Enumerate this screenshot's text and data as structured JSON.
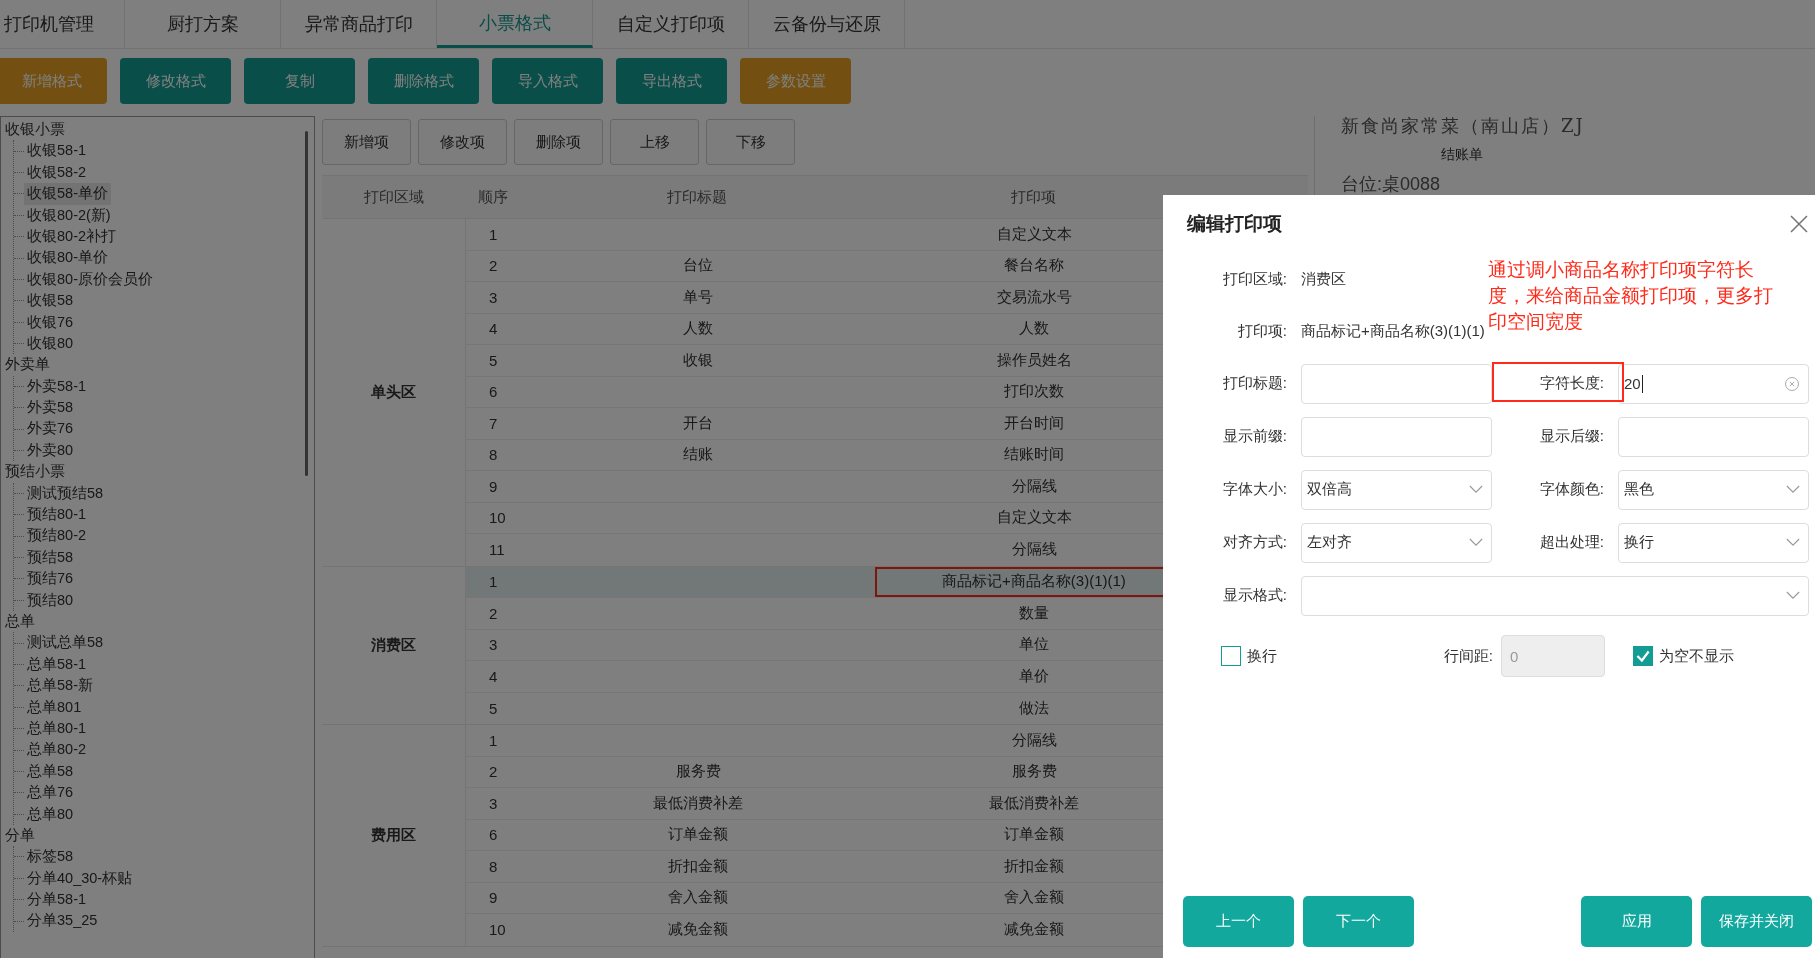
{
  "tabs": [
    {
      "label": "打印机管理",
      "selected": false
    },
    {
      "label": "厨打方案",
      "selected": false
    },
    {
      "label": "异常商品打印",
      "selected": false
    },
    {
      "label": "小票格式",
      "selected": true
    },
    {
      "label": "自定义打印项",
      "selected": false
    },
    {
      "label": "云备份与还原",
      "selected": false
    }
  ],
  "toolbar": [
    {
      "label": "新增格式",
      "kind": "warning"
    },
    {
      "label": "修改格式",
      "kind": "primary"
    },
    {
      "label": "复制",
      "kind": "primary"
    },
    {
      "label": "删除格式",
      "kind": "primary"
    },
    {
      "label": "导入格式",
      "kind": "primary"
    },
    {
      "label": "导出格式",
      "kind": "primary"
    },
    {
      "label": "参数设置",
      "kind": "warning"
    }
  ],
  "tree": [
    {
      "label": "收银小票",
      "children": [
        {
          "label": "收银58-1",
          "selected": false
        },
        {
          "label": "收银58-2",
          "selected": false
        },
        {
          "label": "收银58-单价",
          "selected": true
        },
        {
          "label": "收银80-2(新)",
          "selected": false
        },
        {
          "label": "收银80-2补打",
          "selected": false
        },
        {
          "label": "收银80-单价",
          "selected": false
        },
        {
          "label": "收银80-原价会员价",
          "selected": false
        },
        {
          "label": "收银58",
          "selected": false
        },
        {
          "label": "收银76",
          "selected": false
        },
        {
          "label": "收银80",
          "selected": false
        }
      ]
    },
    {
      "label": "外卖单",
      "children": [
        {
          "label": "外卖58-1",
          "selected": false
        },
        {
          "label": "外卖58",
          "selected": false
        },
        {
          "label": "外卖76",
          "selected": false
        },
        {
          "label": "外卖80",
          "selected": false
        }
      ]
    },
    {
      "label": "预结小票",
      "children": [
        {
          "label": "测试预结58",
          "selected": false
        },
        {
          "label": "预结80-1",
          "selected": false
        },
        {
          "label": "预结80-2",
          "selected": false
        },
        {
          "label": "预结58",
          "selected": false
        },
        {
          "label": "预结76",
          "selected": false
        },
        {
          "label": "预结80",
          "selected": false
        }
      ]
    },
    {
      "label": "总单",
      "children": [
        {
          "label": "测试总单58",
          "selected": false
        },
        {
          "label": "总单58-1",
          "selected": false
        },
        {
          "label": "总单58-新",
          "selected": false
        },
        {
          "label": "总单801",
          "selected": false
        },
        {
          "label": "总单80-1",
          "selected": false
        },
        {
          "label": "总单80-2",
          "selected": false
        },
        {
          "label": "总单58",
          "selected": false
        },
        {
          "label": "总单76",
          "selected": false
        },
        {
          "label": "总单80",
          "selected": false
        }
      ]
    },
    {
      "label": "分单",
      "children": [
        {
          "label": "标签58",
          "selected": false
        },
        {
          "label": "分单40_30-杯贴",
          "selected": false
        },
        {
          "label": "分单58-1",
          "selected": false
        },
        {
          "label": "分单35_25",
          "selected": false
        }
      ]
    }
  ],
  "item_toolbar": [
    "新增项",
    "修改项",
    "删除项",
    "上移",
    "下移"
  ],
  "table": {
    "columns": [
      "打印区域",
      "顺序",
      "打印标题",
      "打印项"
    ],
    "groups": [
      {
        "area": "单头区",
        "rows": [
          {
            "order": "1",
            "item": "自定义文本",
            "selected": false,
            "marked": false
          },
          {
            "order": "2",
            "title": "台位",
            "item": "餐台名称",
            "selected": false,
            "marked": false
          },
          {
            "order": "3",
            "title": "单号",
            "item": "交易流水号",
            "selected": false,
            "marked": false
          },
          {
            "order": "4",
            "title": "人数",
            "item": "人数",
            "selected": false,
            "marked": false
          },
          {
            "order": "5",
            "title": "收银",
            "item": "操作员姓名",
            "selected": false,
            "marked": false
          },
          {
            "order": "6",
            "item": "打印次数",
            "selected": false,
            "marked": false
          },
          {
            "order": "7",
            "title": "开台",
            "item": "开台时间",
            "selected": false,
            "marked": false
          },
          {
            "order": "8",
            "title": "结账",
            "item": "结账时间",
            "selected": false,
            "marked": false
          },
          {
            "order": "9",
            "item": "分隔线",
            "selected": false,
            "marked": false
          },
          {
            "order": "10",
            "item": "自定义文本",
            "selected": false,
            "marked": false
          },
          {
            "order": "11",
            "item": "分隔线",
            "selected": false,
            "marked": false
          }
        ]
      },
      {
        "area": "消费区",
        "rows": [
          {
            "order": "1",
            "item": "商品标记+商品名称(3)(1)(1)",
            "selected": true,
            "marked": true
          },
          {
            "order": "2",
            "item": "数量",
            "selected": false,
            "marked": false
          },
          {
            "order": "3",
            "item": "单位",
            "selected": false,
            "marked": false
          },
          {
            "order": "4",
            "item": "单价",
            "selected": false,
            "marked": false
          },
          {
            "order": "5",
            "item": "做法",
            "selected": false,
            "marked": false
          }
        ]
      },
      {
        "area": "费用区",
        "rows": [
          {
            "order": "1",
            "item": "分隔线",
            "selected": false,
            "marked": false
          },
          {
            "order": "2",
            "title": "服务费",
            "item": "服务费",
            "selected": false,
            "marked": false
          },
          {
            "order": "3",
            "title": "最低消费补差",
            "item": "最低消费补差",
            "selected": false,
            "marked": false
          },
          {
            "order": "6",
            "title": "订单金额",
            "item": "订单金额",
            "selected": false,
            "marked": false
          },
          {
            "order": "8",
            "title": "折扣金额",
            "item": "折扣金额",
            "selected": false,
            "marked": false
          },
          {
            "order": "9",
            "title": "舍入金额",
            "item": "舍入金额",
            "selected": false,
            "marked": false
          },
          {
            "order": "10",
            "title": "减免金额",
            "item": "减免金额",
            "selected": false,
            "marked": false
          }
        ]
      }
    ]
  },
  "preview": {
    "shop": "新食尚家常菜（南山店）ZJ",
    "doc": "结账单",
    "table_line": "台位:桌0088"
  },
  "dialog": {
    "title": "编辑打印项",
    "info": [
      {
        "label": "打印区域:",
        "value": "消费区"
      },
      {
        "label": "打印项:",
        "value": "商品标记+商品名称(3)(1)(1)"
      }
    ],
    "note": "通过调小商品名称打印项字符长度，来给商品金额打印项，更多打印空间宽度",
    "form": [
      [
        {
          "label": "打印标题:",
          "kind": "input",
          "marked": false
        },
        {
          "label": "字符长度:",
          "kind": "input",
          "value": "20",
          "marked": true
        }
      ],
      [
        {
          "label": "显示前缀:",
          "kind": "input",
          "marked": false
        },
        {
          "label": "显示后缀:",
          "kind": "input",
          "marked": false
        }
      ],
      [
        {
          "label": "字体大小:",
          "kind": "select",
          "value": "双倍高",
          "marked": false
        },
        {
          "label": "字体颜色:",
          "kind": "select",
          "value": "黑色",
          "marked": false
        }
      ],
      [
        {
          "label": "对齐方式:",
          "kind": "select",
          "value": "左对齐",
          "marked": false
        },
        {
          "label": "超出处理:",
          "kind": "select",
          "value": "换行",
          "marked": false
        }
      ],
      [
        {
          "label": "显示格式:",
          "kind": "select",
          "marked": false
        }
      ]
    ],
    "wrap": {
      "label": "换行",
      "checked": false
    },
    "spacing": {
      "label": "行间距:",
      "value": "0",
      "disabled": true
    },
    "hide_empty": {
      "label": "为空不显示",
      "checked": true
    },
    "buttons_left": [
      "上一个",
      "下一个"
    ],
    "buttons_right": [
      "应用",
      "保存并关闭"
    ]
  }
}
